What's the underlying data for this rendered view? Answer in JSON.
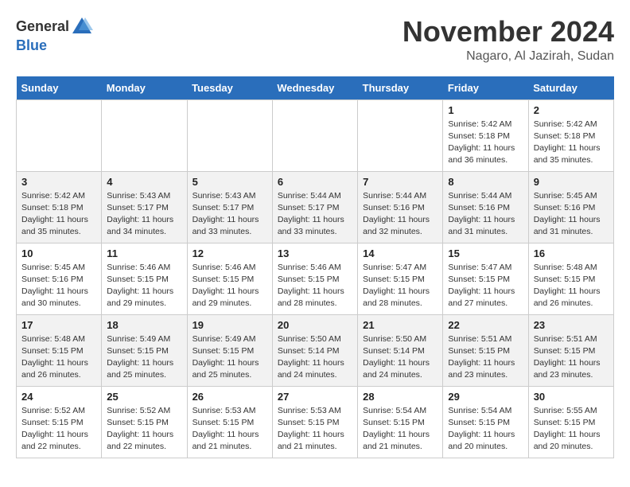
{
  "header": {
    "logo_general": "General",
    "logo_blue": "Blue",
    "month": "November 2024",
    "location": "Nagaro, Al Jazirah, Sudan"
  },
  "weekdays": [
    "Sunday",
    "Monday",
    "Tuesday",
    "Wednesday",
    "Thursday",
    "Friday",
    "Saturday"
  ],
  "weeks": [
    [
      {
        "day": "",
        "info": ""
      },
      {
        "day": "",
        "info": ""
      },
      {
        "day": "",
        "info": ""
      },
      {
        "day": "",
        "info": ""
      },
      {
        "day": "",
        "info": ""
      },
      {
        "day": "1",
        "info": "Sunrise: 5:42 AM\nSunset: 5:18 PM\nDaylight: 11 hours\nand 36 minutes."
      },
      {
        "day": "2",
        "info": "Sunrise: 5:42 AM\nSunset: 5:18 PM\nDaylight: 11 hours\nand 35 minutes."
      }
    ],
    [
      {
        "day": "3",
        "info": "Sunrise: 5:42 AM\nSunset: 5:18 PM\nDaylight: 11 hours\nand 35 minutes."
      },
      {
        "day": "4",
        "info": "Sunrise: 5:43 AM\nSunset: 5:17 PM\nDaylight: 11 hours\nand 34 minutes."
      },
      {
        "day": "5",
        "info": "Sunrise: 5:43 AM\nSunset: 5:17 PM\nDaylight: 11 hours\nand 33 minutes."
      },
      {
        "day": "6",
        "info": "Sunrise: 5:44 AM\nSunset: 5:17 PM\nDaylight: 11 hours\nand 33 minutes."
      },
      {
        "day": "7",
        "info": "Sunrise: 5:44 AM\nSunset: 5:16 PM\nDaylight: 11 hours\nand 32 minutes."
      },
      {
        "day": "8",
        "info": "Sunrise: 5:44 AM\nSunset: 5:16 PM\nDaylight: 11 hours\nand 31 minutes."
      },
      {
        "day": "9",
        "info": "Sunrise: 5:45 AM\nSunset: 5:16 PM\nDaylight: 11 hours\nand 31 minutes."
      }
    ],
    [
      {
        "day": "10",
        "info": "Sunrise: 5:45 AM\nSunset: 5:16 PM\nDaylight: 11 hours\nand 30 minutes."
      },
      {
        "day": "11",
        "info": "Sunrise: 5:46 AM\nSunset: 5:15 PM\nDaylight: 11 hours\nand 29 minutes."
      },
      {
        "day": "12",
        "info": "Sunrise: 5:46 AM\nSunset: 5:15 PM\nDaylight: 11 hours\nand 29 minutes."
      },
      {
        "day": "13",
        "info": "Sunrise: 5:46 AM\nSunset: 5:15 PM\nDaylight: 11 hours\nand 28 minutes."
      },
      {
        "day": "14",
        "info": "Sunrise: 5:47 AM\nSunset: 5:15 PM\nDaylight: 11 hours\nand 28 minutes."
      },
      {
        "day": "15",
        "info": "Sunrise: 5:47 AM\nSunset: 5:15 PM\nDaylight: 11 hours\nand 27 minutes."
      },
      {
        "day": "16",
        "info": "Sunrise: 5:48 AM\nSunset: 5:15 PM\nDaylight: 11 hours\nand 26 minutes."
      }
    ],
    [
      {
        "day": "17",
        "info": "Sunrise: 5:48 AM\nSunset: 5:15 PM\nDaylight: 11 hours\nand 26 minutes."
      },
      {
        "day": "18",
        "info": "Sunrise: 5:49 AM\nSunset: 5:15 PM\nDaylight: 11 hours\nand 25 minutes."
      },
      {
        "day": "19",
        "info": "Sunrise: 5:49 AM\nSunset: 5:15 PM\nDaylight: 11 hours\nand 25 minutes."
      },
      {
        "day": "20",
        "info": "Sunrise: 5:50 AM\nSunset: 5:14 PM\nDaylight: 11 hours\nand 24 minutes."
      },
      {
        "day": "21",
        "info": "Sunrise: 5:50 AM\nSunset: 5:14 PM\nDaylight: 11 hours\nand 24 minutes."
      },
      {
        "day": "22",
        "info": "Sunrise: 5:51 AM\nSunset: 5:15 PM\nDaylight: 11 hours\nand 23 minutes."
      },
      {
        "day": "23",
        "info": "Sunrise: 5:51 AM\nSunset: 5:15 PM\nDaylight: 11 hours\nand 23 minutes."
      }
    ],
    [
      {
        "day": "24",
        "info": "Sunrise: 5:52 AM\nSunset: 5:15 PM\nDaylight: 11 hours\nand 22 minutes."
      },
      {
        "day": "25",
        "info": "Sunrise: 5:52 AM\nSunset: 5:15 PM\nDaylight: 11 hours\nand 22 minutes."
      },
      {
        "day": "26",
        "info": "Sunrise: 5:53 AM\nSunset: 5:15 PM\nDaylight: 11 hours\nand 21 minutes."
      },
      {
        "day": "27",
        "info": "Sunrise: 5:53 AM\nSunset: 5:15 PM\nDaylight: 11 hours\nand 21 minutes."
      },
      {
        "day": "28",
        "info": "Sunrise: 5:54 AM\nSunset: 5:15 PM\nDaylight: 11 hours\nand 21 minutes."
      },
      {
        "day": "29",
        "info": "Sunrise: 5:54 AM\nSunset: 5:15 PM\nDaylight: 11 hours\nand 20 minutes."
      },
      {
        "day": "30",
        "info": "Sunrise: 5:55 AM\nSunset: 5:15 PM\nDaylight: 11 hours\nand 20 minutes."
      }
    ]
  ]
}
